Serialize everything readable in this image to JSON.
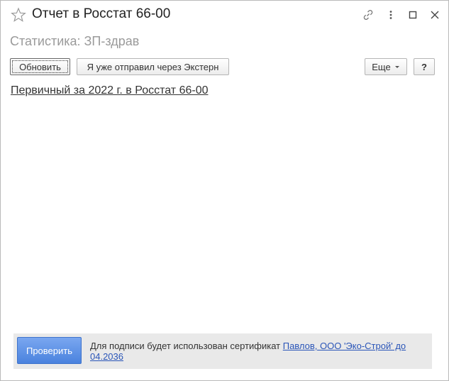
{
  "window": {
    "title": "Отчет в Росстат 66-00"
  },
  "form": {
    "subtitle": "Статистика: ЗП-здрав"
  },
  "toolbar": {
    "refresh_label": "Обновить",
    "sent_extern_label": "Я уже отправил через Экстерн",
    "more_label": "Еще",
    "help_label": "?"
  },
  "report": {
    "link_text": "Первичный за 2022 г. в Росстат 66-00"
  },
  "footer": {
    "check_label": "Проверить",
    "cert_prefix": "Для подписи будет использован сертификат ",
    "cert_link": "Павлов, ООО 'Эко-Строй' до 04.2036"
  },
  "icons": {
    "favorite": "star-icon",
    "link": "link-icon",
    "menu": "more-vertical-icon",
    "maximize": "maximize-icon",
    "close": "close-icon"
  },
  "colors": {
    "primary_button": "#4a82de",
    "link": "#2a55b8",
    "subtitle": "#9a9a9a",
    "footer_bg": "#e9e9e9"
  }
}
